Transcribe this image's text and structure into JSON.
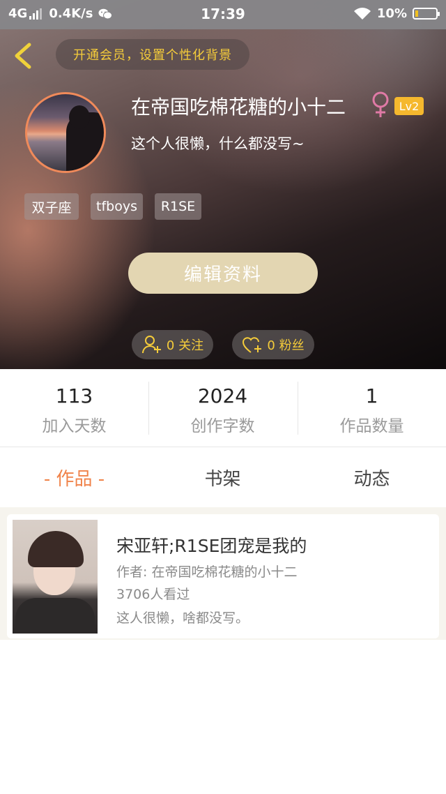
{
  "status_bar": {
    "network": "4G",
    "speed": "0.4K/s",
    "time": "17:39",
    "battery": "10%",
    "battery_level": 0.1
  },
  "header": {
    "vip_prompt": "开通会员，设置个性化背景",
    "username": "在帝国吃棉花糖的小十二",
    "gender_symbol": "♀",
    "level": "Lv2",
    "bio": "这个人很懒，什么都没写~",
    "tags": [
      "双子座",
      "tfboys",
      "R1SE"
    ],
    "edit_button": "编辑资料",
    "following": "0 关注",
    "fans": "0 粉丝",
    "colors": {
      "accent_yellow": "#f5cc3a",
      "level_badge": "#f5b82e",
      "edit_button": "#e3d6b2",
      "avatar_ring": "#f08a5a"
    }
  },
  "stats": [
    {
      "value": "113",
      "label": "加入天数"
    },
    {
      "value": "2024",
      "label": "创作字数"
    },
    {
      "value": "1",
      "label": "作品数量"
    }
  ],
  "tabs": [
    {
      "label": "- 作品 -",
      "active": true
    },
    {
      "label": "书架",
      "active": false
    },
    {
      "label": "动态",
      "active": false
    }
  ],
  "works": [
    {
      "title": "宋亚轩;R1SE团宠是我的",
      "author": "作者: 在帝国吃棉花糖的小十二",
      "views": "3706人看过",
      "intro": "这人很懒，啥都没写。"
    }
  ],
  "theme": {
    "active_tab_color": "#f0834a"
  }
}
